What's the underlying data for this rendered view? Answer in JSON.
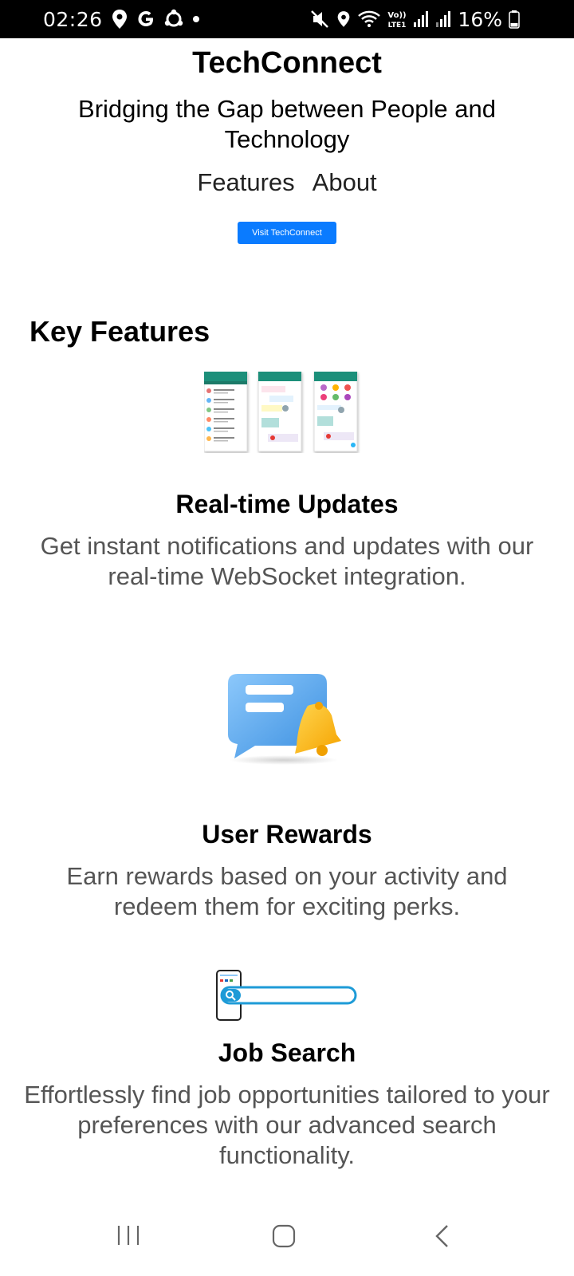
{
  "status_bar": {
    "time": "02:26",
    "battery": "16%",
    "left_icons": [
      "location-icon",
      "google-icon",
      "sync-icon",
      "dot-icon"
    ],
    "right_icons": [
      "mute-icon",
      "location-icon",
      "wifi-icon",
      "volte-icon",
      "signal-icon",
      "signal-icon",
      "battery-icon"
    ],
    "volte_label": "Vo)) LTE1"
  },
  "header": {
    "title": "TechConnect",
    "tagline": "Bridging the Gap between People and Technology",
    "nav": [
      "Features",
      "About"
    ],
    "cta_label": "Visit TechConnect",
    "accent_color": "#0a7bff"
  },
  "features": {
    "heading": "Key Features",
    "items": [
      {
        "title": "Real-time Updates",
        "description": "Get instant notifications and updates with our real-time WebSocket integration.",
        "image": "app-screens-illustration"
      },
      {
        "title": "User Rewards",
        "description": "Earn rewards based on your activity and redeem them for exciting perks.",
        "image": "chat-bell-illustration"
      },
      {
        "title": "Job Search",
        "description": "Effortlessly find job opportunities tailored to your preferences with our advanced search functionality.",
        "image": "phone-search-illustration"
      }
    ]
  },
  "system_nav": {
    "buttons": [
      "recents-icon",
      "home-icon",
      "back-icon"
    ]
  }
}
